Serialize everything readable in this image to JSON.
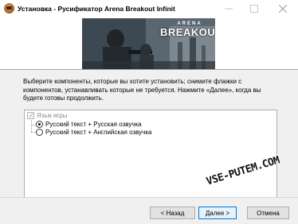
{
  "window": {
    "title": "Установка - Русификатор Arena Breakout Infinit",
    "icon": "installer-app-icon"
  },
  "banner": {
    "logo_top": "ARENA",
    "logo_main": "BREAKOUT"
  },
  "instructions": "Выберите компоненты, которые вы хотите установить; снимите флажки с компонентов, устанавливать которые не требуется. Нажмите «Далее», когда вы будете готовы продолжить.",
  "components": {
    "group": {
      "label": "Язык игры",
      "checked": true,
      "disabled": true
    },
    "options": [
      {
        "label": "Русский текст + Русская озвучка",
        "selected": true
      },
      {
        "label": "Русский текст + Английская озвучка",
        "selected": false
      }
    ]
  },
  "watermark": "VSE-PUTEM.COM",
  "buttons": {
    "back": "< Назад",
    "next": "Далее >",
    "cancel": "Отмена"
  },
  "colors": {
    "accent": "#0078d7",
    "panel": "#f0f0f0"
  }
}
